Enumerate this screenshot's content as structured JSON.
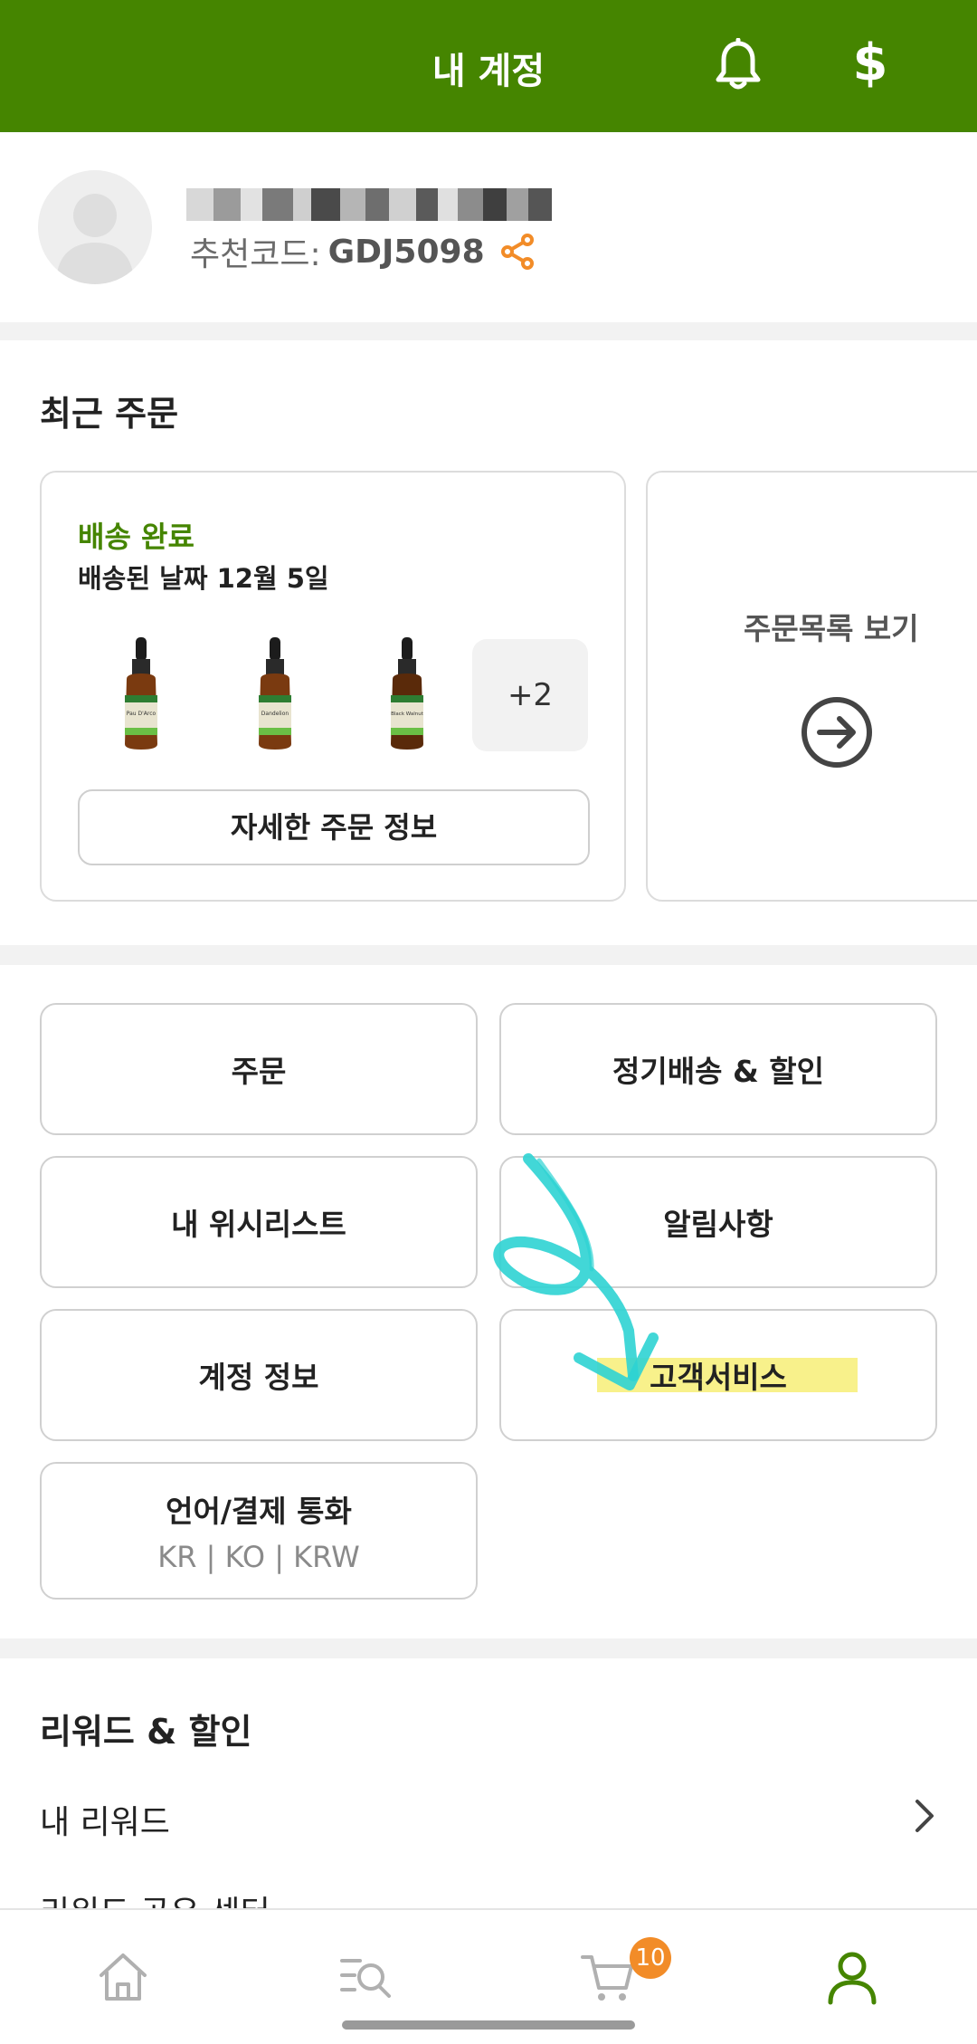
{
  "header": {
    "title": "내 계정"
  },
  "profile": {
    "referral_label": "추천코드:",
    "referral_code": "GDJ5098"
  },
  "recent_orders": {
    "title": "최근 주문",
    "order": {
      "status": "배송 완료",
      "delivered_date": "배송된 날짜 12월 5일",
      "extra_items": "+2",
      "detail_button": "자세한 주문 정보",
      "bottle_labels": [
        "Pau D'Arco",
        "Dandelion",
        "Black Walnut"
      ]
    },
    "view_all": "주문목록 보기"
  },
  "menu": {
    "orders": "주문",
    "autoship": "정기배송 & 할인",
    "wishlist": "내 위시리스트",
    "notifications": "알림사항",
    "account_info": "계정 정보",
    "customer_service": "고객서비스",
    "language_currency": "언어/결제 통화",
    "language_currency_value": "KR | KO | KRW"
  },
  "rewards": {
    "title": "리워드 & 할인",
    "my_rewards": "내 리워드",
    "reward_share_center": "리워드 공유 센터"
  },
  "bottom_nav": {
    "cart_count": "10"
  },
  "colors": {
    "brand_green": "#458500",
    "accent_orange": "#f28c28",
    "highlight_yellow": "#f5ec64",
    "annotation_cyan": "#2ed3d3"
  }
}
